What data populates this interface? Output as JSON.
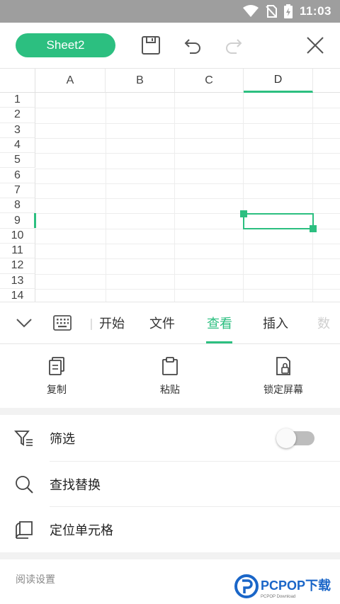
{
  "status_bar": {
    "time": "11:03"
  },
  "toolbar": {
    "sheet_name": "Sheet2"
  },
  "grid": {
    "columns": [
      "A",
      "B",
      "C",
      "D"
    ],
    "rows": [
      "1",
      "2",
      "3",
      "4",
      "5",
      "6",
      "7",
      "8",
      "9",
      "10",
      "11",
      "12",
      "13",
      "14"
    ],
    "active_column": "D",
    "active_row": "9"
  },
  "tabs": {
    "items": [
      "开始",
      "文件",
      "查看",
      "插入",
      "数"
    ],
    "active": "查看"
  },
  "actions": {
    "copy": "复制",
    "paste": "粘贴",
    "lock_screen": "锁定屏幕"
  },
  "options": {
    "filter": "筛选",
    "filter_enabled": false,
    "find_replace": "查找替换",
    "goto_cell": "定位单元格"
  },
  "reading_settings": {
    "title": "阅读设置"
  },
  "watermark": {
    "brand": "PCPOP下载",
    "sub": "PCPOP Download"
  },
  "colors": {
    "accent": "#2cbf80",
    "status_bar": "#9e9e9e"
  }
}
